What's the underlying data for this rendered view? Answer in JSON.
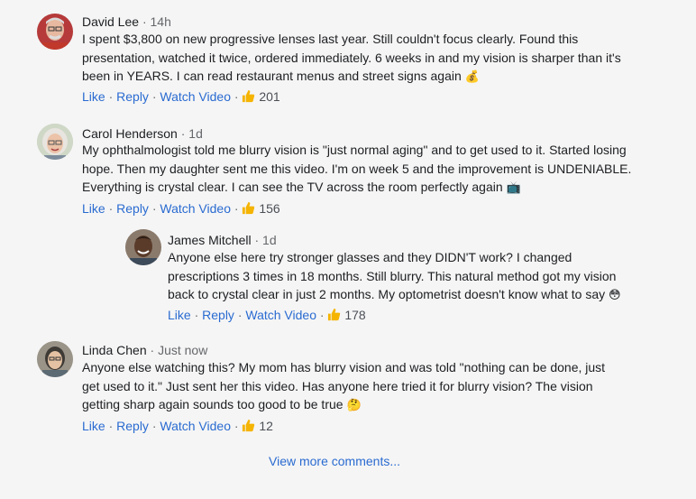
{
  "comments": [
    {
      "name": "David Lee",
      "time": "14h",
      "text": "I spent $3,800 on new progressive lenses last year. Still couldn't focus clearly. Found this presentation, watched it twice, ordered immediately. 6 weeks in and my vision is sharper than it's been in YEARS. I can read restaurant menus and street signs again",
      "emoji": "💰",
      "like": "Like",
      "reply": "Reply",
      "watch": "Watch Video",
      "likes": "201"
    },
    {
      "name": "Carol Henderson",
      "time": "1d",
      "text": "My ophthalmologist told me blurry vision is \"just normal aging\" and to get used to it. Started losing hope. Then my daughter sent me this video. I'm on week 5 and the improvement is UNDENIABLE. Everything is crystal clear. I can see the TV across the room perfectly again",
      "emoji": "📺",
      "like": "Like",
      "reply": "Reply",
      "watch": "Watch Video",
      "likes": "156"
    },
    {
      "name": "James Mitchell",
      "time": "1d",
      "text": "Anyone else here try stronger glasses and they DIDN'T work? I changed prescriptions 3 times in 18 months. Still blurry. This natural method got my vision back to crystal clear in just 2 months. My optometrist doesn't know what to say",
      "emoji": "😳",
      "like": "Like",
      "reply": "Reply",
      "watch": "Watch Video",
      "likes": "178"
    },
    {
      "name": "Linda Chen",
      "time": "Just now",
      "text": "Anyone else watching this? My mom has blurry vision and was told \"nothing can be done, just get used to it.\" Just sent her this video. Has anyone here tried it for blurry vision? The vision getting sharp again sounds too good to be true",
      "emoji": "🤔",
      "like": "Like",
      "reply": "Reply",
      "watch": "Watch Video",
      "likes": "12"
    }
  ],
  "view_more": "View more comments...",
  "separator": "·",
  "colors": {
    "link": "#2a6bd1",
    "meta": "#65676b",
    "background": "#f5f5f5",
    "thumb": "#f5b400"
  }
}
